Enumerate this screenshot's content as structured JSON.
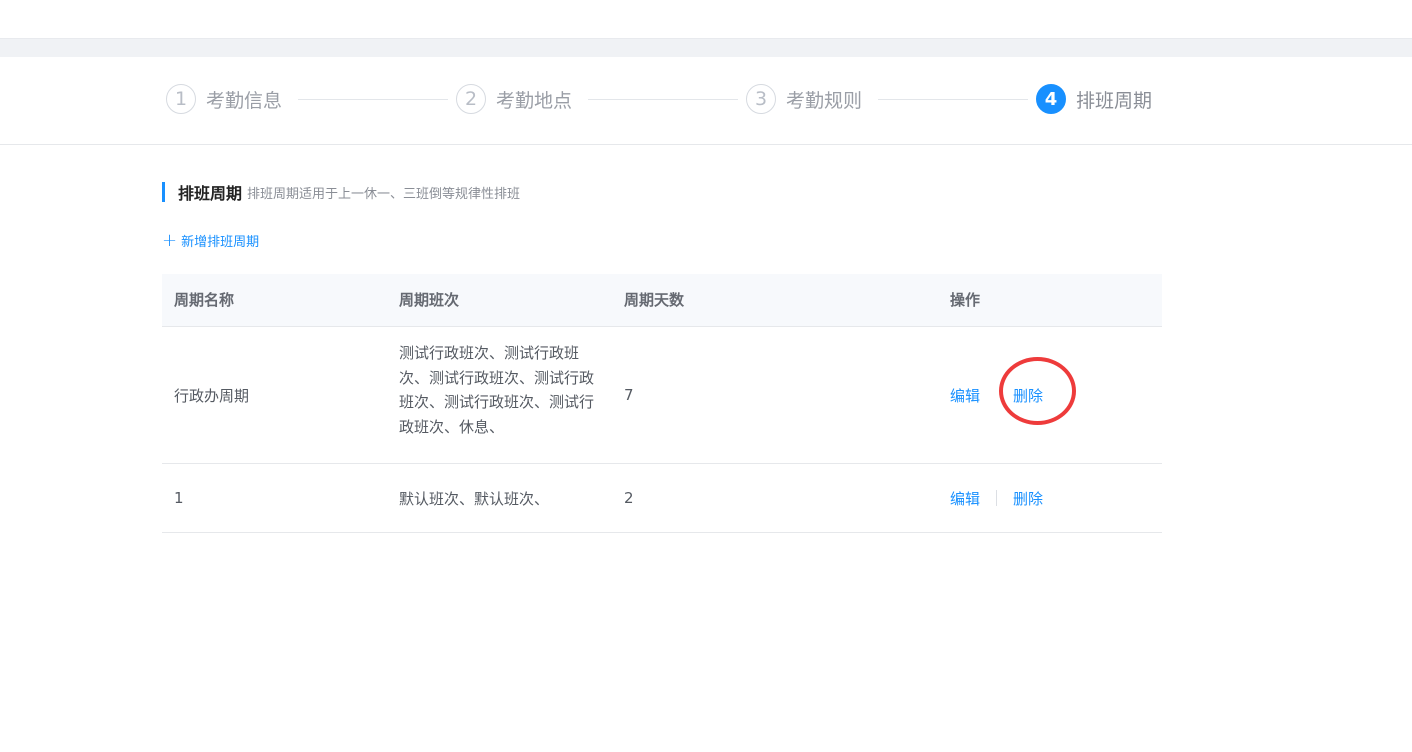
{
  "steps": [
    {
      "number": "1",
      "label": "考勤信息"
    },
    {
      "number": "2",
      "label": "考勤地点"
    },
    {
      "number": "3",
      "label": "考勤规则"
    },
    {
      "number": "4",
      "label": "排班周期"
    }
  ],
  "section": {
    "title": "排班周期",
    "subtitle": "排班周期适用于上一休一、三班倒等规律性排班"
  },
  "add_link": {
    "plus": "+",
    "label": "新增排班周期"
  },
  "table": {
    "headers": [
      "周期名称",
      "周期班次",
      "周期天数",
      "操作"
    ],
    "rows": [
      {
        "name": "行政办周期",
        "shifts": "测试行政班次、测试行政班次、测试行政班次、测试行政班次、测试行政班次、测试行政班次、休息、",
        "days": "7",
        "edit": "编辑",
        "delete": "删除"
      },
      {
        "name": "1",
        "shifts": "默认班次、默认班次、",
        "days": "2",
        "edit": "编辑",
        "delete": "删除"
      }
    ]
  },
  "colors": {
    "accent": "#1890ff",
    "annotation": "#ee3b3b"
  }
}
